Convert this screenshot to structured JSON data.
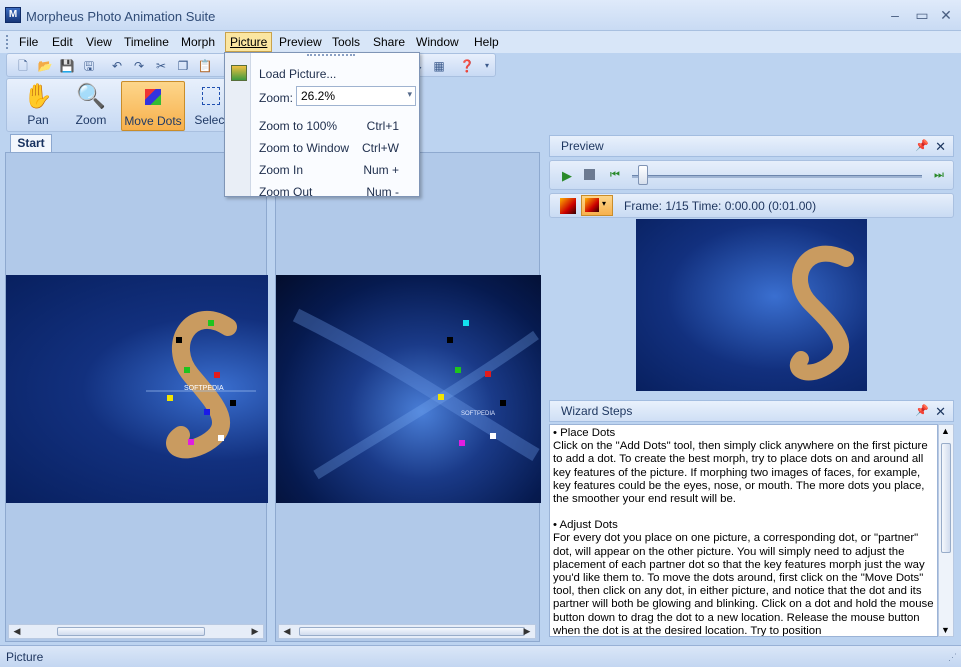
{
  "window": {
    "title": "Morpheus Photo Animation Suite",
    "app_icon": "M"
  },
  "menu": [
    "File",
    "Edit",
    "View",
    "Timeline",
    "Morph",
    "Picture",
    "Preview",
    "Tools",
    "Share",
    "Window",
    "Help"
  ],
  "tools": [
    {
      "label": "Pan",
      "icon": "hand-icon"
    },
    {
      "label": "Zoom",
      "icon": "magnifier-icon"
    },
    {
      "label": "Move Dots",
      "icon": "move-dots-icon"
    },
    {
      "label": "Select",
      "icon": "select-icon"
    }
  ],
  "tab": "Start",
  "picture_menu": {
    "load": "Load Picture...",
    "zoom_label": "Zoom:",
    "zoom_value": "26.2%",
    "items": [
      {
        "label": "Zoom to 100%",
        "shortcut": "Ctrl+1"
      },
      {
        "label": "Zoom to Window",
        "shortcut": "Ctrl+W"
      },
      {
        "label": "Zoom In",
        "shortcut": "Num +"
      },
      {
        "label": "Zoom Out",
        "shortcut": "Num -"
      }
    ]
  },
  "preview": {
    "title": "Preview",
    "frame_info": "Frame: 1/15  Time: 0:00.00 (0:01.00)",
    "progress": 0.0
  },
  "wizard": {
    "title": "Wizard Steps",
    "paragraphs": [
      "• Place Dots",
      "Click on the \"Add Dots\" tool, then simply click anywhere on the first picture to add a dot.  To create the best morph, try to place dots on and around all key features of the picture.  If morphing two images of faces, for example, key features could be the eyes, nose, or mouth.  The more dots you place, the smoother your end result will be.",
      "• Adjust Dots",
      "For every dot you place on one picture, a corresponding dot, or \"partner\" dot, will appear on the other picture.  You will simply need to adjust the placement of each partner dot so that the key features morph just the way you'd like them to.  To move the dots around, first click on the \"Move Dots\" tool, then click on any dot, in either picture, and notice that the dot and its partner will both be glowing and blinking.  Click on a dot and hold the mouse button down to drag the dot to a new location.  Release the mouse button when the dot is at the desired location.  Try to position"
    ]
  },
  "status": {
    "text": "Picture"
  },
  "picture_text": {
    "logo": "SOFTPEDIA",
    "watermark": "www.softpedia.com"
  },
  "colors": {
    "accent": "#f7b04c",
    "image_bg": "#0c2a7a"
  }
}
